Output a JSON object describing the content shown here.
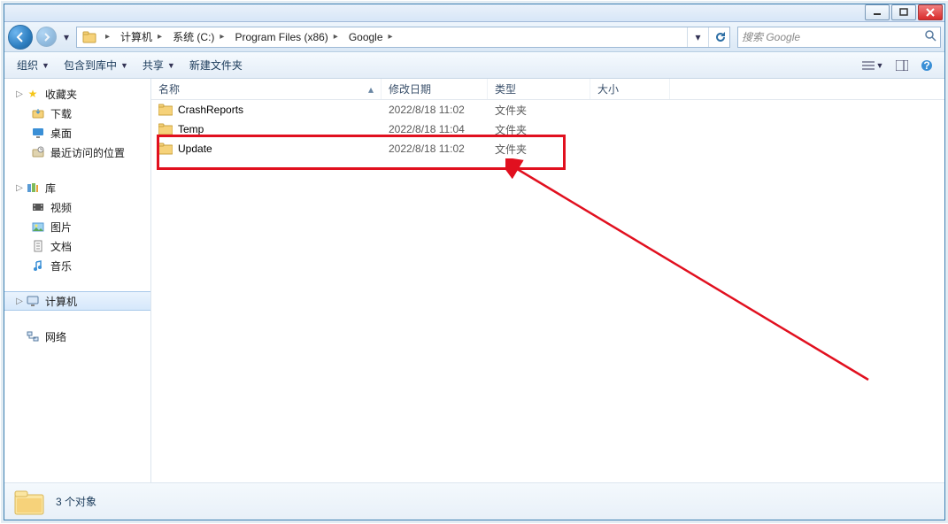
{
  "breadcrumbs": [
    "计算机",
    "系统 (C:)",
    "Program Files (x86)",
    "Google"
  ],
  "search": {
    "placeholder": "搜索 Google"
  },
  "toolbar": {
    "organize": "组织",
    "include": "包含到库中",
    "share": "共享",
    "newfolder": "新建文件夹"
  },
  "sidebar": {
    "favorites": {
      "label": "收藏夹",
      "items": [
        "下载",
        "桌面",
        "最近访问的位置"
      ]
    },
    "libraries": {
      "label": "库",
      "items": [
        "视频",
        "图片",
        "文档",
        "音乐"
      ]
    },
    "computer": {
      "label": "计算机"
    },
    "network": {
      "label": "网络"
    }
  },
  "columns": {
    "name": "名称",
    "date": "修改日期",
    "type": "类型",
    "size": "大小"
  },
  "files": [
    {
      "name": "CrashReports",
      "date": "2022/8/18 11:02",
      "type": "文件夹"
    },
    {
      "name": "Temp",
      "date": "2022/8/18 11:04",
      "type": "文件夹"
    },
    {
      "name": "Update",
      "date": "2022/8/18 11:02",
      "type": "文件夹"
    }
  ],
  "status": {
    "count_label": "3 个对象"
  }
}
